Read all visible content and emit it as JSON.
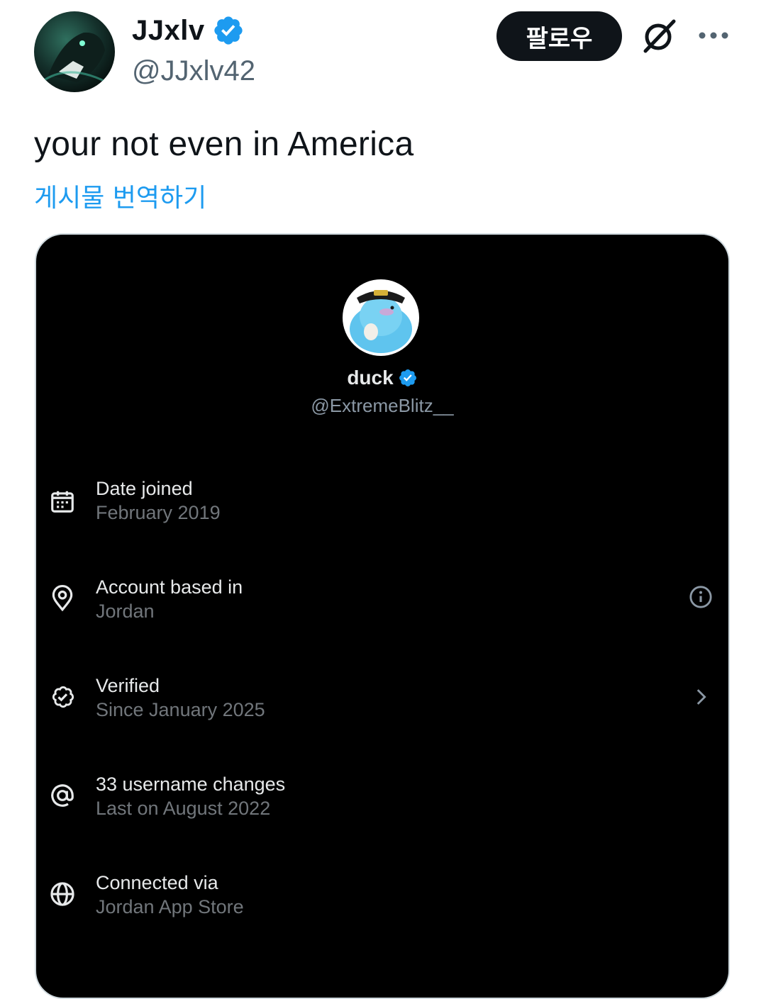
{
  "post": {
    "author_name": "JJxlv",
    "author_handle": "@JJxlv42",
    "follow_label": "팔로우",
    "text": "your not even in America",
    "translate_label": "게시물 번역하기"
  },
  "embedded_profile": {
    "name": "duck",
    "handle": "@ExtremeBlitz__",
    "rows": [
      {
        "icon": "calendar-icon",
        "title": "Date joined",
        "subtitle": "February 2019"
      },
      {
        "icon": "location-pin-icon",
        "title": "Account based in",
        "subtitle": "Jordan",
        "right_icon": "info-icon"
      },
      {
        "icon": "verified-badge-icon",
        "title": "Verified",
        "subtitle": "Since January 2025",
        "right_icon": "chevron-right-icon"
      },
      {
        "icon": "at-sign-icon",
        "title": "33 username changes",
        "subtitle": "Last on August 2022"
      },
      {
        "icon": "globe-icon",
        "title": "Connected via",
        "subtitle": "Jordan App Store"
      }
    ]
  },
  "colors": {
    "accent": "#1d9bf0",
    "text_primary": "#0f1419",
    "text_secondary": "#536471",
    "media_bg": "#000000"
  }
}
